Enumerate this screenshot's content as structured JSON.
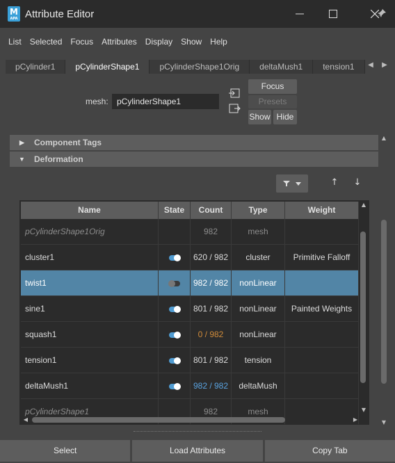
{
  "window": {
    "title": "Attribute Editor",
    "app_icon_letter": "M",
    "app_icon_sub": "APA"
  },
  "menu": [
    "List",
    "Selected",
    "Focus",
    "Attributes",
    "Display",
    "Show",
    "Help"
  ],
  "tabs": [
    {
      "label": "pCylinder1",
      "active": false
    },
    {
      "label": "pCylinderShape1",
      "active": true
    },
    {
      "label": "pCylinderShape1Orig",
      "active": false
    },
    {
      "label": "deltaMush1",
      "active": false
    },
    {
      "label": "tension1",
      "active": false
    }
  ],
  "mesh": {
    "label": "mesh:",
    "value": "pCylinderShape1"
  },
  "buttons": {
    "focus": "Focus",
    "presets": "Presets",
    "show": "Show",
    "hide": "Hide"
  },
  "sections": {
    "component_tags": "Component Tags",
    "deformation": "Deformation"
  },
  "table": {
    "columns": [
      "Name",
      "State",
      "Count",
      "Type",
      "Weight"
    ],
    "rows": [
      {
        "name": "pCylinderShape1Orig",
        "state": "",
        "count": "982",
        "type": "mesh",
        "weight": "",
        "dim": true,
        "selected": false,
        "count_color": "#8c8c8c"
      },
      {
        "name": "cluster1",
        "state": "on",
        "count": "620 / 982",
        "type": "cluster",
        "weight": "Primitive Falloff",
        "dim": false,
        "selected": false,
        "count_color": "#dcdcdc"
      },
      {
        "name": "twist1",
        "state": "off",
        "count": "982 / 982",
        "type": "nonLinear",
        "weight": "",
        "dim": false,
        "selected": true,
        "count_color": "#ffffff"
      },
      {
        "name": "sine1",
        "state": "on",
        "count": "801 / 982",
        "type": "nonLinear",
        "weight": "Painted Weights",
        "dim": false,
        "selected": false,
        "count_color": "#dcdcdc"
      },
      {
        "name": "squash1",
        "state": "on",
        "count": "0 / 982",
        "type": "nonLinear",
        "weight": "",
        "dim": false,
        "selected": false,
        "count_color": "#d08b3a"
      },
      {
        "name": "tension1",
        "state": "on",
        "count": "801 / 982",
        "type": "tension",
        "weight": "",
        "dim": false,
        "selected": false,
        "count_color": "#dcdcdc"
      },
      {
        "name": "deltaMush1",
        "state": "on",
        "count": "982 / 982",
        "type": "deltaMush",
        "weight": "",
        "dim": false,
        "selected": false,
        "count_color": "#5aa3e0"
      },
      {
        "name": "pCylinderShape1",
        "state": "",
        "count": "982",
        "type": "mesh",
        "weight": "",
        "dim": true,
        "selected": false,
        "count_color": "#8c8c8c"
      }
    ]
  },
  "bottom_buttons": {
    "select": "Select",
    "load_attributes": "Load Attributes",
    "copy_tab": "Copy Tab"
  },
  "colors": {
    "accent": "#5285a6",
    "toggle_on": "#4f9bd1"
  }
}
